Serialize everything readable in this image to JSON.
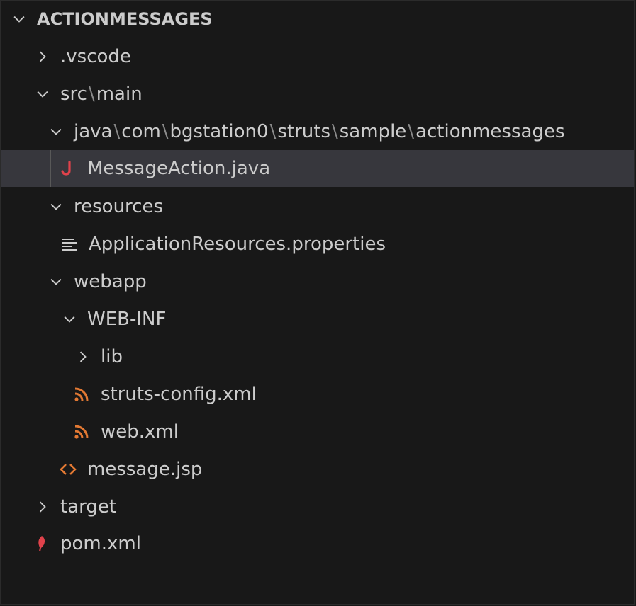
{
  "explorer": {
    "title": "ACTIONMESSAGES"
  },
  "tree": {
    "vscode": ".vscode",
    "src_main": {
      "parts": [
        "src",
        "main"
      ],
      "separator": "\\"
    },
    "java_pkg": {
      "parts": [
        "java",
        "com",
        "bgstation0",
        "struts",
        "sample",
        "actionmessages"
      ],
      "separator": "\\"
    },
    "message_action": "MessageAction.java",
    "resources": "resources",
    "app_resources": "ApplicationResources.properties",
    "webapp": "webapp",
    "web_inf": "WEB-INF",
    "lib": "lib",
    "struts_config": "struts-config.xml",
    "web_xml": "web.xml",
    "message_jsp": "message.jsp",
    "target": "target",
    "pom": "pom.xml"
  },
  "colors": {
    "background": "#181818",
    "selected_row": "#37373d",
    "text": "#cccccc",
    "java_icon": "#e0424b",
    "xml_icon": "#e37933",
    "jsp_icon": "#e37933",
    "maven_icon": "#e0424b",
    "properties_icon": "#cccccc"
  }
}
